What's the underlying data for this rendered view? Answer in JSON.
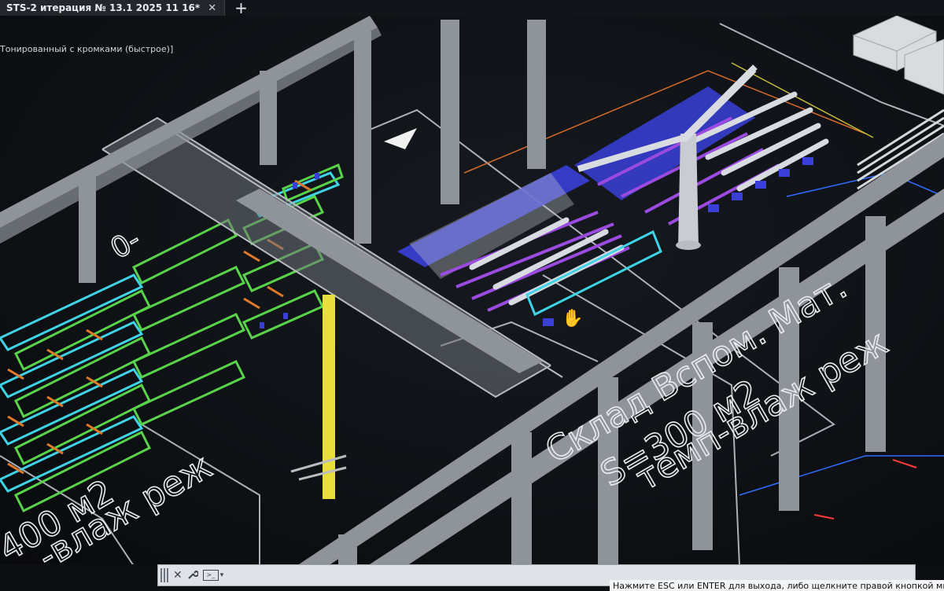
{
  "tab": {
    "title": "STS-2 итерация № 13.1 2025 11 16*",
    "close_icon": "✕",
    "add_icon": "+"
  },
  "viewport": {
    "controls_label": "Тонированный с кромками (быстрое)]",
    "labels": {
      "area_right_line1": "Склад Вспом. Мат.",
      "area_right_line2": "S=300 м2",
      "area_right_line3": "темп-влаж реж",
      "area_left_line1": "400 м2",
      "area_left_line2": "-влаж реж",
      "area_top_fragment": "0-"
    }
  },
  "command_line": {
    "close_icon": "✕",
    "wrench_icon": "wrench-icon",
    "prompt_icon": "command-prompt-icon",
    "input_value": ""
  },
  "status": {
    "hint": "Нажмите ESC или ENTER для выхода, либо щелкните правой кнопкой мыши"
  },
  "colors": {
    "background": "#0c0e12",
    "structure": "#8f949b",
    "rack_cyan": "#3fd3e6",
    "rack_green": "#59d34a",
    "beam_orange": "#e07a2a",
    "blue_parts": "#3a3fd8",
    "purple_parts": "#9b4be0",
    "yellow_column": "#e8df3a",
    "text_white": "#e8ecef"
  }
}
